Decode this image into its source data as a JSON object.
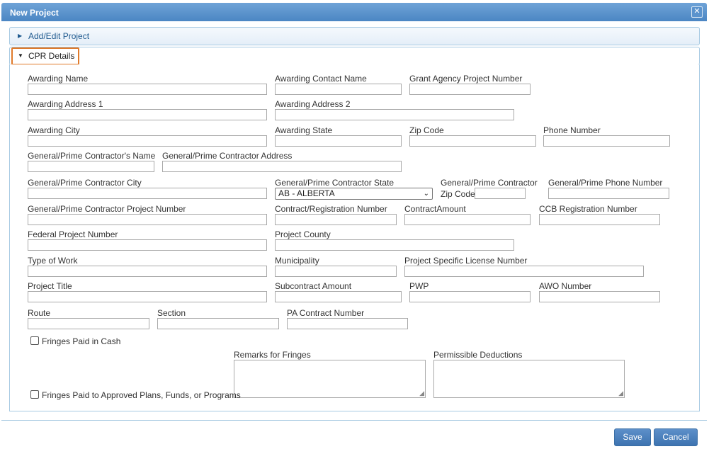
{
  "window": {
    "title": "New Project",
    "close_icon": "✕"
  },
  "sections": {
    "add_edit": {
      "label": "Add/Edit Project"
    },
    "cpr": {
      "label": "CPR Details"
    }
  },
  "fields": {
    "awarding_name": "Awarding Name",
    "awarding_contact_name": "Awarding Contact Name",
    "grant_agency_project_number": "Grant Agency Project Number",
    "awarding_address_1": "Awarding Address 1",
    "awarding_address_2": "Awarding Address 2",
    "awarding_city": "Awarding City",
    "awarding_state": "Awarding State",
    "zip_code": "Zip Code",
    "phone_number": "Phone Number",
    "prime_contractor_name": "General/Prime Contractor's Name",
    "prime_contractor_address": "General/Prime Contractor Address",
    "prime_contractor_city": "General/Prime Contractor City",
    "prime_contractor_state": "General/Prime Contractor State",
    "prime_contractor_zip_line1": "General/Prime Contractor",
    "prime_contractor_zip_line2": "Zip Code",
    "prime_phone_number": "General/Prime Phone Number",
    "prime_contractor_project_number": "General/Prime Contractor Project Number",
    "contract_registration_number": "Contract/Registration Number",
    "contract_amount": "ContractAmount",
    "ccb_registration_number": "CCB Registration Number",
    "federal_project_number": "Federal Project Number",
    "project_county": "Project County",
    "type_of_work": "Type of Work",
    "municipality": "Municipality",
    "project_specific_license_number": "Project Specific License Number",
    "project_title": "Project Title",
    "subcontract_amount": "Subcontract Amount",
    "pwp": "PWP",
    "awo_number": "AWO Number",
    "route": "Route",
    "section": "Section",
    "pa_contract_number": "PA Contract Number",
    "remarks_for_fringes": "Remarks for Fringes",
    "permissible_deductions": "Permissible Deductions"
  },
  "state_select": {
    "selected": "AB - ALBERTA"
  },
  "checkboxes": {
    "fringes_cash": "Fringes Paid in Cash",
    "fringes_plans": "Fringes Paid to Approved Plans, Funds, or Programs"
  },
  "buttons": {
    "save": "Save",
    "cancel": "Cancel"
  },
  "colors": {
    "titlebar": "#4b86c3",
    "highlight": "#e07a2b",
    "button": "#3d73b0"
  }
}
